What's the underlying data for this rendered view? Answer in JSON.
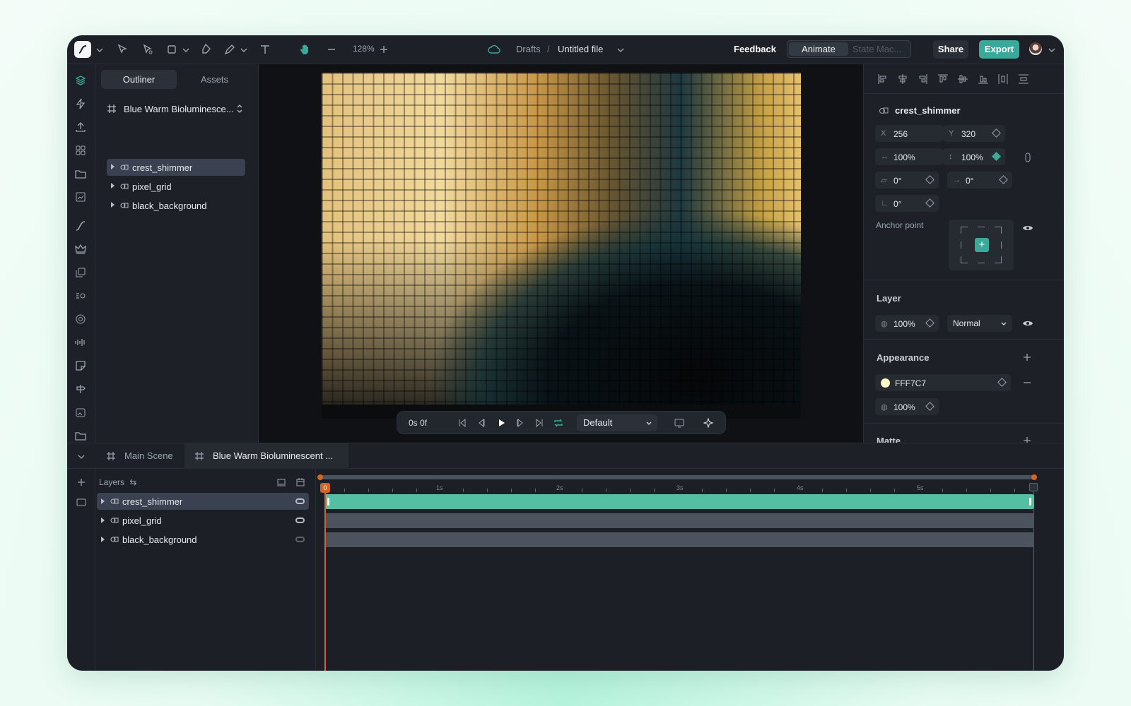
{
  "app": {
    "zoom": "128%",
    "brand_color": "#3ba89a",
    "timeline_color": "#d9641f"
  },
  "breadcrumb": {
    "folder": "Drafts",
    "separator": "/",
    "file": "Untitled file"
  },
  "topbar": {
    "feedback": "Feedback",
    "mode_active": "Animate",
    "mode_inactive": "State Mac...",
    "share": "Share",
    "export": "Export"
  },
  "outliner": {
    "tabs": [
      "Outliner",
      "Assets"
    ],
    "composition": "Blue Warm Bioluminesce...",
    "items": [
      {
        "label": "crest_shimmer",
        "selected": true
      },
      {
        "label": "pixel_grid",
        "selected": false
      },
      {
        "label": "black_background",
        "selected": false
      }
    ]
  },
  "player": {
    "time": "0s 0f",
    "preset": "Default"
  },
  "properties": {
    "object": "crest_shimmer",
    "x_label": "X",
    "x": "256",
    "y_label": "Y",
    "y": "320",
    "width_scale": "100%",
    "height_scale": "100%",
    "skew": "0°",
    "rotation": "0°",
    "skew_axis": "0°",
    "anchor_label": "Anchor point",
    "layer_title": "Layer",
    "layer_opacity": "100%",
    "blend_mode": "Normal",
    "appearance_title": "Appearance",
    "fill_hex": "FFF7C7",
    "fill_color": "#FFF7C7",
    "fill_opacity": "100%",
    "matte_title": "Matte"
  },
  "timeline": {
    "tabs": [
      "Main Scene",
      "Blue Warm Bioluminescent ..."
    ],
    "layers_label": "Layers",
    "layers": [
      {
        "label": "crest_shimmer",
        "selected": true
      },
      {
        "label": "pixel_grid",
        "selected": false
      },
      {
        "label": "black_background",
        "selected": false
      }
    ],
    "playhead": "0",
    "ruler_labels": [
      "1s",
      "2s",
      "3s",
      "4s",
      "5s"
    ]
  }
}
